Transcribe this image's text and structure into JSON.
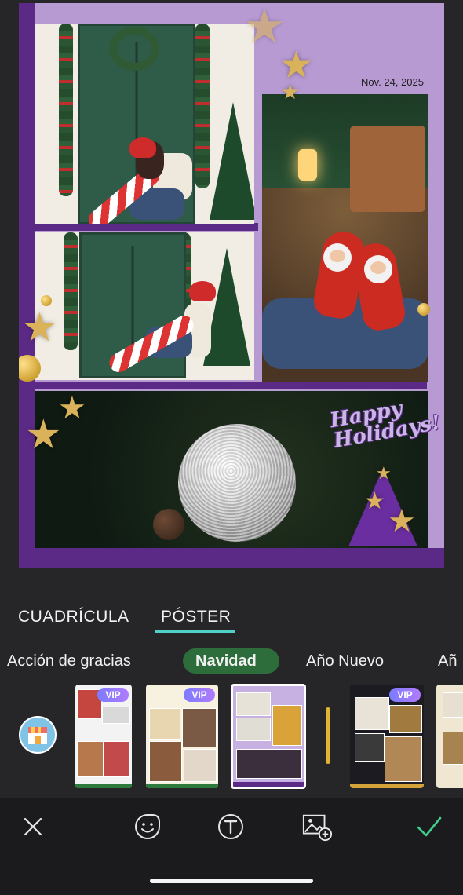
{
  "poster": {
    "date": "Nov. 24, 2025",
    "greeting": "Happy Holidays!"
  },
  "tabs": [
    {
      "label": "CUADRÍCULA",
      "active": false
    },
    {
      "label": "PÓSTER",
      "active": true
    }
  ],
  "categories": [
    {
      "label": "Acción de gracias",
      "active": false
    },
    {
      "label": "Navidad",
      "active": true
    },
    {
      "label": "Año Nuevo",
      "active": false
    },
    {
      "label": "Añ",
      "active": false
    }
  ],
  "templates": [
    {
      "badge": "VIP"
    },
    {
      "badge": "VIP"
    },
    {
      "selected": true
    },
    {
      "badge": "VIP"
    }
  ],
  "colors": {
    "poster_bg": "#b89ad3",
    "poster_frame": "#5b2a86",
    "accent_underline": "#4fd1c5",
    "category_active_bg": "#2d6d3b",
    "confirm": "#3ecf8e"
  },
  "icons": {
    "store": "store-icon",
    "close": "close-icon",
    "sticker": "sticker-icon",
    "text": "text-icon",
    "add_image": "add-image-icon",
    "confirm": "check-icon"
  }
}
